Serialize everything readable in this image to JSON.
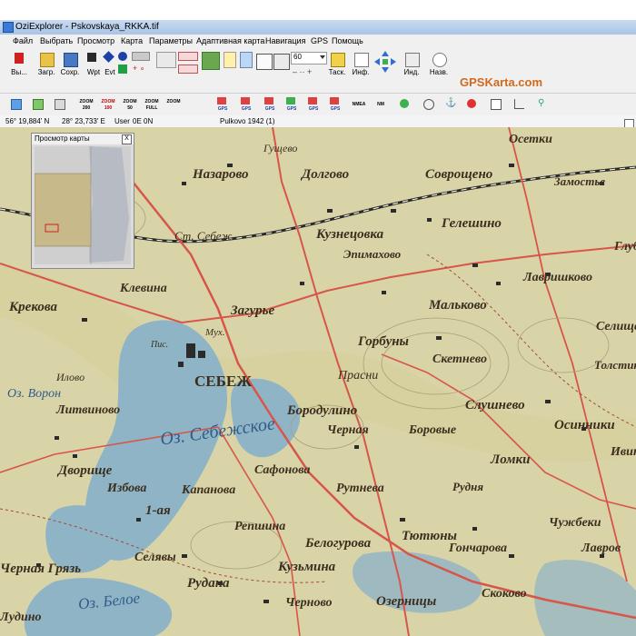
{
  "title": "OziExplorer - Pskovskaya_RKKA.tif",
  "menu": [
    "Файл",
    "Выбрать",
    "Просмотр",
    "Карта",
    "Параметры",
    "Адаптивная карта",
    "Навигация",
    "GPS",
    "Помощь"
  ],
  "toolbar": {
    "exit_label": "Вы...",
    "load_label": "Загр.",
    "save_label": "Сохр.",
    "wpt_label": "Wpt",
    "evt_label": "Evt",
    "zoom_value": "60",
    "task_label": "Таск.",
    "info_label": "Инф.",
    "index_label": "Инд.",
    "name_label": "Назв.",
    "brand": "GPSKarta.com"
  },
  "toolbar2": {
    "zoom_buttons": [
      {
        "top": "ZOOM",
        "bottom": "200"
      },
      {
        "top": "ZOOM",
        "bottom": "100"
      },
      {
        "top": "ZOOM",
        "bottom": "50"
      },
      {
        "top": "ZOOM",
        "bottom": "FULL"
      },
      {
        "top": "ZOOM",
        "bottom": ""
      }
    ],
    "gps_buttons": [
      "GPS",
      "GPS",
      "GPS",
      "GPS",
      "GPS",
      "GPS"
    ],
    "small_labels": [
      "NMEA",
      "NM"
    ]
  },
  "status": {
    "lat": "56° 19,884' N",
    "lon": "28° 23,733' E",
    "user": "User",
    "user_value": "0E  0N",
    "datum": "Pulkovo 1942 (1)"
  },
  "overview": {
    "title": "Просмотр карты",
    "close": "X"
  },
  "colors": {
    "map_bg": "#d9d3a8",
    "water": "#8fb4c6",
    "road": "#d8554a",
    "brand": "#d2691e"
  },
  "map_labels": [
    "Осетки",
    "Гущево",
    "Назарово",
    "Долгово",
    "Соврощено",
    "Замостье",
    "Гелешино",
    "Глубо",
    "Кузнецовка",
    "Эпимахово",
    "Лавришково",
    "Ст. Себеж",
    "Клевина",
    "Крекова",
    "Загурье",
    "Мальково",
    "Селище",
    "Мух.",
    "Пис.",
    "Горбуны",
    "Скетнево",
    "Толстик",
    "СЕБЕЖ",
    "Прасни",
    "Илово",
    "Оз. Ворон",
    "Слушнево",
    "Бородулино",
    "Осинники",
    "Литвиново",
    "Оз. Себежское",
    "Черная",
    "Боровые",
    "Ломки",
    "Дворище",
    "Сафонова",
    "Ивин",
    "Избова",
    "Капанова",
    "Рутнева",
    "Рудня",
    "Чужбеки",
    "1-ая",
    "Репшина",
    "Тютюны",
    "Белогурова",
    "Гончарова",
    "Лавров",
    "Селявы",
    "Кузьмина",
    "Черная Грязь",
    "Рудана",
    "Оз. Белое",
    "Черново",
    "Озерницы",
    "Скоково",
    "Лудино"
  ]
}
